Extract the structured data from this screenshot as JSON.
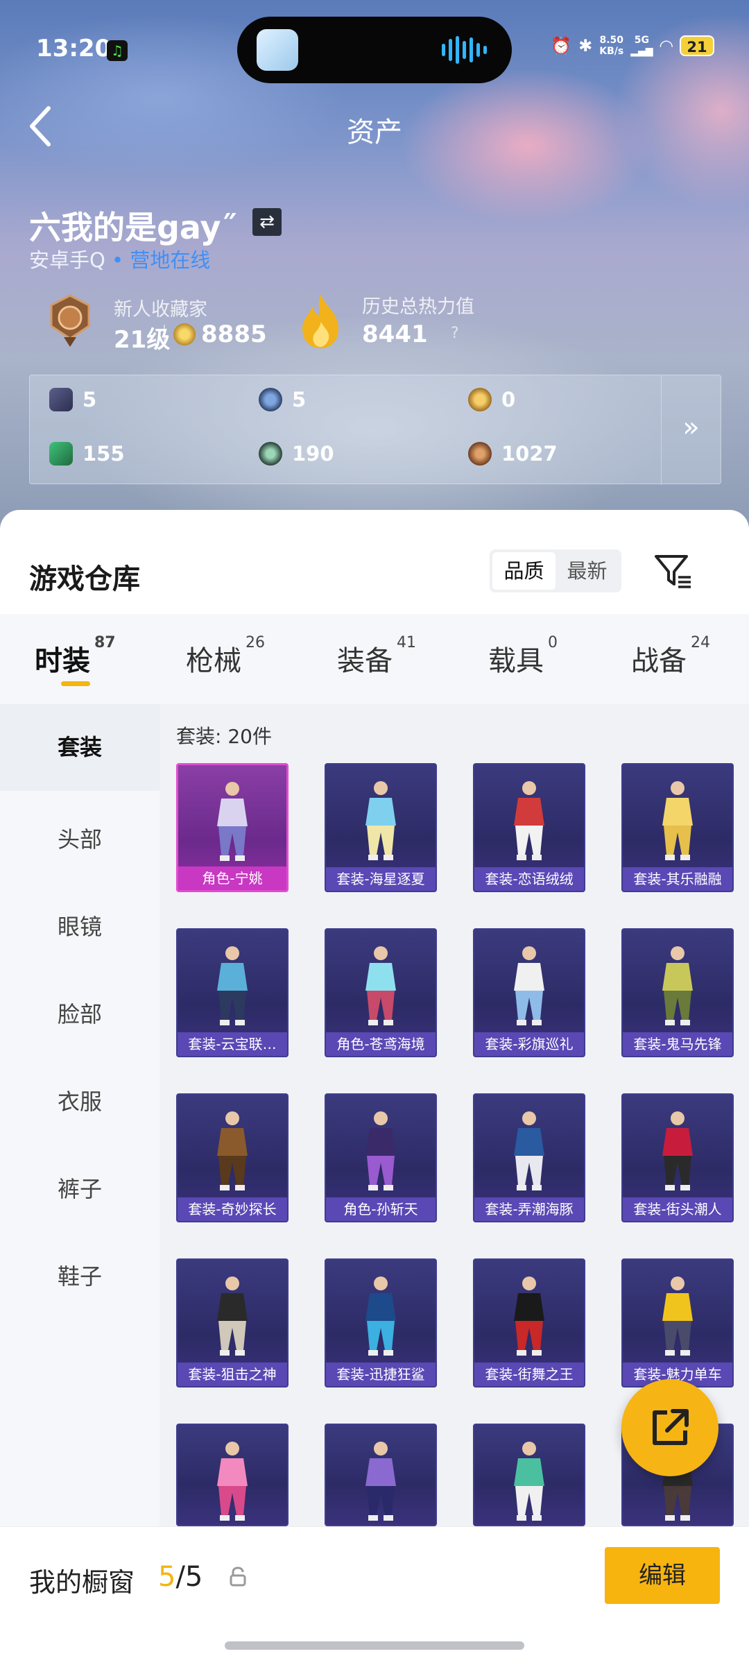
{
  "status_bar": {
    "time": "13:20",
    "net_speed": "8.50",
    "net_unit": "KB/s",
    "signal": "5G",
    "battery": "21"
  },
  "header": {
    "title": "资产"
  },
  "profile": {
    "name": "六我的是gay˝",
    "platform": "安卓手Q",
    "camp_status": "营地在线",
    "rank_title": "新人收藏家",
    "level": "21级",
    "coins": "8885",
    "heat_title": "历史总热力值",
    "heat_value": "8441",
    "heat_help": "?"
  },
  "stats": [
    {
      "icon": "card-icon",
      "value": "5"
    },
    {
      "icon": "silver-token-icon",
      "value": "5"
    },
    {
      "icon": "gold-token-icon",
      "value": "0"
    },
    {
      "icon": "ticket-icon",
      "value": "155"
    },
    {
      "icon": "gem-icon",
      "value": "190"
    },
    {
      "icon": "bronze-token-icon",
      "value": "1027"
    }
  ],
  "warehouse": {
    "title": "游戏仓库",
    "sort_options": [
      "品质",
      "最新"
    ],
    "sort_selected": "品质",
    "tabs": [
      {
        "label": "时装",
        "count": "87"
      },
      {
        "label": "枪械",
        "count": "26"
      },
      {
        "label": "装备",
        "count": "41"
      },
      {
        "label": "载具",
        "count": "0"
      },
      {
        "label": "战备",
        "count": "24"
      }
    ],
    "categories": [
      "套装",
      "头部",
      "眼镜",
      "脸部",
      "衣服",
      "裤子",
      "鞋子"
    ],
    "count_label": "套装: 20件",
    "items": [
      "角色-宁姚",
      "套装-海星逐夏",
      "套装-恋语绒绒",
      "套装-其乐融融",
      "套装-云宝联…",
      "角色-苍鸢海境",
      "套装-彩旗巡礼",
      "套装-鬼马先锋",
      "套装-奇妙探长",
      "角色-孙斩天",
      "套装-弄潮海豚",
      "套装-街头潮人",
      "套装-狙击之神",
      "套装-迅捷狂鲨",
      "套装-街舞之王",
      "套装-魅力单车",
      "",
      "",
      "",
      ""
    ]
  },
  "showcase": {
    "label": "我的橱窗",
    "current": "5",
    "total": "/5",
    "edit_label": "编辑"
  },
  "colors": {
    "accent": "#f6b514",
    "card_bg": "#2d2b66",
    "highlight": "#c838c2",
    "link": "#3f8ff7"
  }
}
